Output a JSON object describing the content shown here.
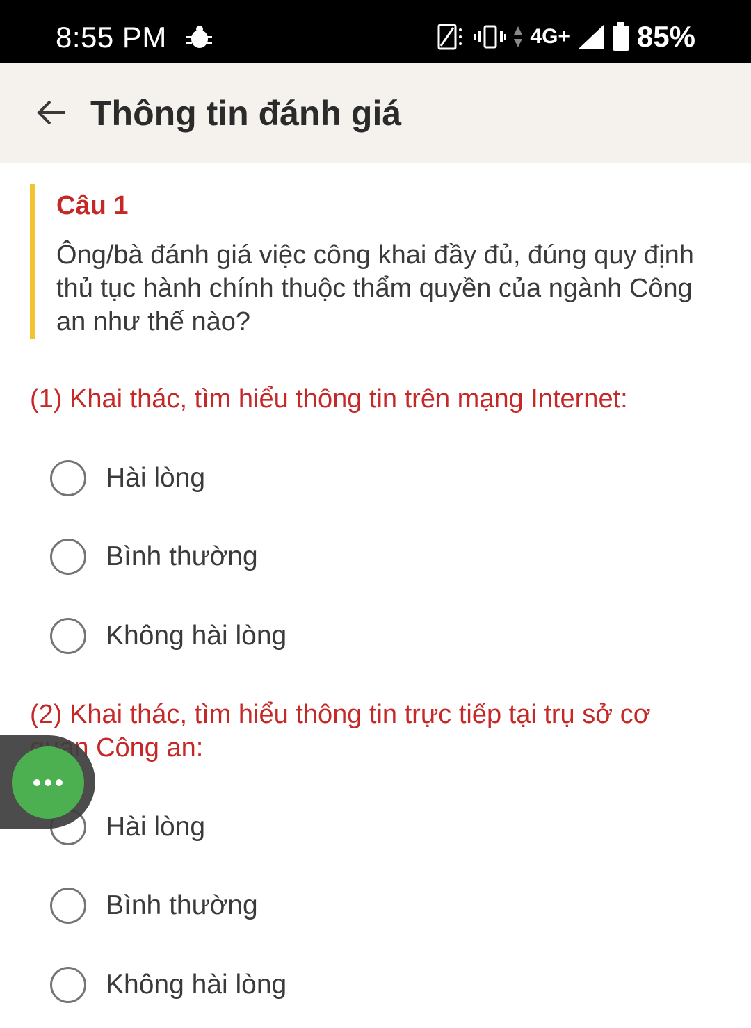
{
  "status_bar": {
    "time": "8:55 PM",
    "network": "4G+",
    "battery": "85%",
    "icons": [
      "bug-icon",
      "no-sim-icon",
      "vibrate-icon",
      "data-arrows-icon",
      "signal-icon",
      "battery-icon"
    ]
  },
  "app_bar": {
    "title": "Thông tin đánh giá",
    "back_icon": "arrow-left-icon"
  },
  "question": {
    "number": "Câu 1",
    "text": "Ông/bà đánh giá việc công khai đầy đủ, đúng quy định thủ tục hành chính thuộc thẩm quyền của ngành Công an như thế nào?",
    "accent_color": "#f4c430"
  },
  "sub_questions": [
    {
      "label": "(1) Khai thác, tìm hiểu thông tin trên mạng Internet:",
      "options": [
        "Hài lòng",
        "Bình thường",
        "Không hài lòng"
      ]
    },
    {
      "label": "(2) Khai thác, tìm hiểu thông tin trực tiếp tại trụ sở cơ quan Công an:",
      "options": [
        "Hài lòng",
        "Bình thường",
        "Không hài lòng"
      ]
    }
  ],
  "colors": {
    "title_red": "#c62828",
    "fab_green": "#4caf50",
    "app_bar_bg": "#f5f2ee"
  },
  "fab": {
    "icon": "more-horizontal-icon"
  }
}
